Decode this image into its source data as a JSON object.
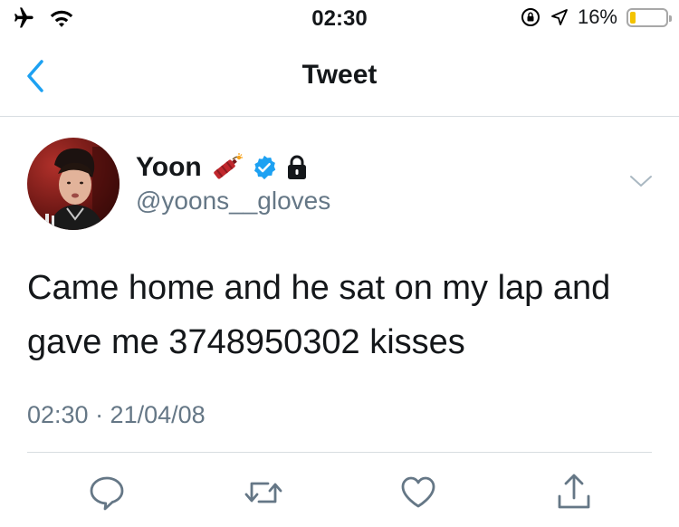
{
  "status_bar": {
    "time": "02:30",
    "battery_text": "16%",
    "battery_level": 0.16,
    "icons": [
      "airplane-icon",
      "wifi-icon",
      "orientation-lock-icon",
      "location-arrow-icon",
      "battery-icon"
    ]
  },
  "nav": {
    "title": "Tweet",
    "back_icon": "chevron-left-icon"
  },
  "tweet": {
    "display_name": "Yoon",
    "handle": "@yoons__gloves",
    "name_icons": [
      "firecracker-emoji",
      "verified-badge-icon",
      "lock-icon"
    ],
    "text": "Came home and he sat on my lap and gave me 3748950302 kisses",
    "meta": "02:30 · 21/04/08",
    "menu_icon": "chevron-down-icon"
  },
  "actions": [
    {
      "name": "reply",
      "icon": "comment-icon"
    },
    {
      "name": "retweet",
      "icon": "retweet-icon"
    },
    {
      "name": "like",
      "icon": "heart-icon"
    },
    {
      "name": "share",
      "icon": "share-icon"
    }
  ],
  "colors": {
    "accent": "#1da1f2",
    "secondary_text": "#657786",
    "divider": "#d8dde1",
    "battery": "#f3c300"
  }
}
